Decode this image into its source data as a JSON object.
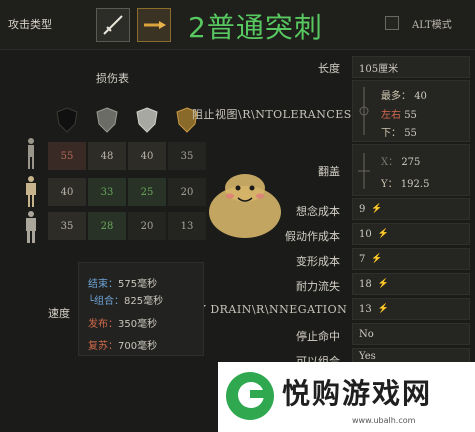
{
  "header": {
    "attack_type_label": "攻击类型",
    "attack_title": "2普通突刺",
    "alt_mode_label": "ALT模式",
    "weapon_icons": [
      "sword-icon",
      "spear-icon"
    ]
  },
  "damage_table": {
    "title": "损伤表",
    "shield_icons": [
      "black-shield-icon",
      "gray-shield-icon",
      "silver-shield-icon",
      "gold-shield-icon"
    ],
    "rows": [
      {
        "icon": "body-front-icon",
        "cells": [
          "55",
          "48",
          "40",
          "35"
        ]
      },
      {
        "icon": "body-armored-icon",
        "cells": [
          "40",
          "33",
          "25",
          "20"
        ]
      },
      {
        "icon": "body-heavy-icon",
        "cells": [
          "35",
          "28",
          "20",
          "13"
        ]
      }
    ]
  },
  "speed": {
    "label": "速度",
    "lines": [
      {
        "key": "结束：",
        "value": "575毫秒",
        "color": "blue"
      },
      {
        "key": "└组合：",
        "value": "825毫秒",
        "color": "blue"
      },
      {
        "key": "发布：",
        "value": "350毫秒",
        "color": "red"
      },
      {
        "key": "复苏：",
        "value": "700毫秒",
        "color": "red"
      }
    ]
  },
  "overlays": {
    "tolerances": "阻止视图\\R\\NTOLERANCES",
    "parry": "PARRY DRAIN\\R\\NNEGATION"
  },
  "properties": {
    "length_label": "长度",
    "length_value": "105厘米",
    "reach": {
      "max": {
        "key": "最多：",
        "value": "40"
      },
      "lr": {
        "key": "左右",
        "value": "55"
      },
      "down": {
        "key": "下：",
        "value": "55"
      }
    },
    "cover_label": "翻盖",
    "cover": {
      "x": {
        "key": "X：",
        "value": "275"
      },
      "y": {
        "key": "Y：",
        "value": "192.5"
      }
    },
    "rows": [
      {
        "label": "想念成本",
        "value": "9"
      },
      {
        "label": "假动作成本",
        "value": "10"
      },
      {
        "label": "变形成本",
        "value": "7"
      },
      {
        "label": "耐力流失",
        "value": "18"
      },
      {
        "label": "",
        "value": "13"
      }
    ],
    "stop_label": "停止命中",
    "stop_value": "No",
    "combo_label": "可以组合",
    "combo_value": "Yes"
  },
  "footer": {
    "brand": "悦购游戏网",
    "url": "www.ubalh.com"
  },
  "colors": {
    "accent_green": "#58c860",
    "blue_key": "#6ea5d8",
    "red_key": "#d06a4a"
  }
}
